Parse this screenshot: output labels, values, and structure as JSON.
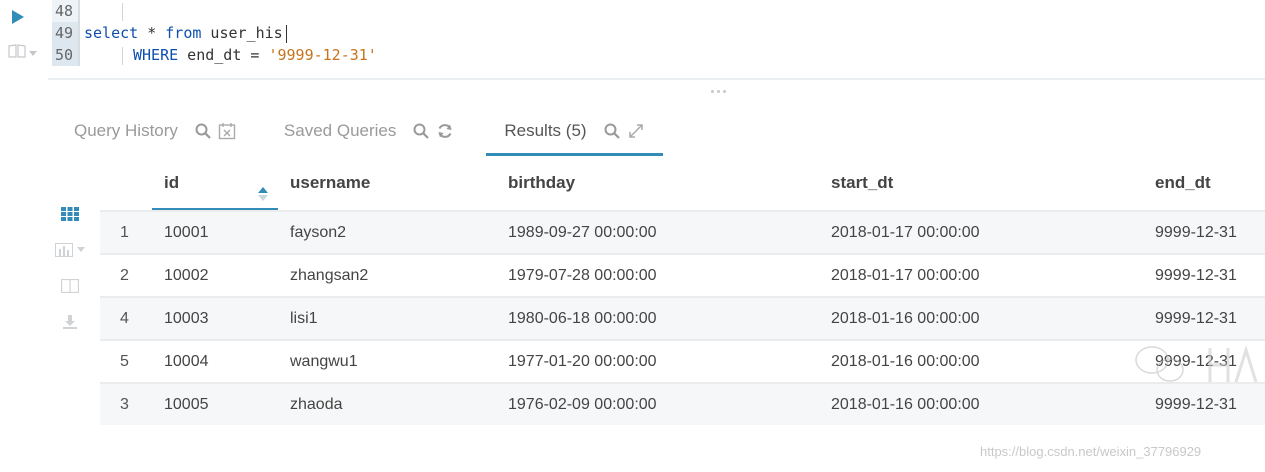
{
  "editor": {
    "line_numbers": [
      "48",
      "49",
      "50"
    ],
    "line49": {
      "kw1": "select",
      "rest1": " * ",
      "kw2": "from",
      "rest2": " user_his"
    },
    "line50": {
      "kw1": "WHERE",
      "rest1": " end_dt = ",
      "str": "'9999-12-31'"
    }
  },
  "tabs": [
    {
      "label": "Query History",
      "active": false
    },
    {
      "label": "Saved Queries",
      "active": false
    },
    {
      "label": "Results (5)",
      "active": true
    }
  ],
  "icons": {
    "run": "play-icon",
    "snippets": "book-icon",
    "search": "search-icon",
    "calendar": "calendar-clear-icon",
    "refresh": "refresh-icon",
    "expand": "expand-icon",
    "grid": "grid-icon",
    "chart": "bar-chart-icon",
    "columns": "columns-icon",
    "download": "download-icon"
  },
  "colors": {
    "accent": "#338bb8",
    "run": "#338bb8",
    "keyword": "#0d4fae",
    "string": "#c6741c"
  },
  "table": {
    "columns": [
      "id",
      "username",
      "birthday",
      "start_dt",
      "end_dt"
    ],
    "rows": [
      {
        "idx": "1",
        "id": "10001",
        "username": "fayson2",
        "birthday": "1989-09-27 00:00:00",
        "start_dt": "2018-01-17 00:00:00",
        "end_dt": "9999-12-31"
      },
      {
        "idx": "2",
        "id": "10002",
        "username": "zhangsan2",
        "birthday": "1979-07-28 00:00:00",
        "start_dt": "2018-01-17 00:00:00",
        "end_dt": "9999-12-31"
      },
      {
        "idx": "4",
        "id": "10003",
        "username": "lisi1",
        "birthday": "1980-06-18 00:00:00",
        "start_dt": "2018-01-16 00:00:00",
        "end_dt": "9999-12-31"
      },
      {
        "idx": "5",
        "id": "10004",
        "username": "wangwu1",
        "birthday": "1977-01-20 00:00:00",
        "start_dt": "2018-01-16 00:00:00",
        "end_dt": "9999-12-31"
      },
      {
        "idx": "3",
        "id": "10005",
        "username": "zhaoda",
        "birthday": "1976-02-09 00:00:00",
        "start_dt": "2018-01-16 00:00:00",
        "end_dt": "9999-12-31"
      }
    ]
  },
  "watermark": "https://blog.csdn.net/weixin_37796929"
}
